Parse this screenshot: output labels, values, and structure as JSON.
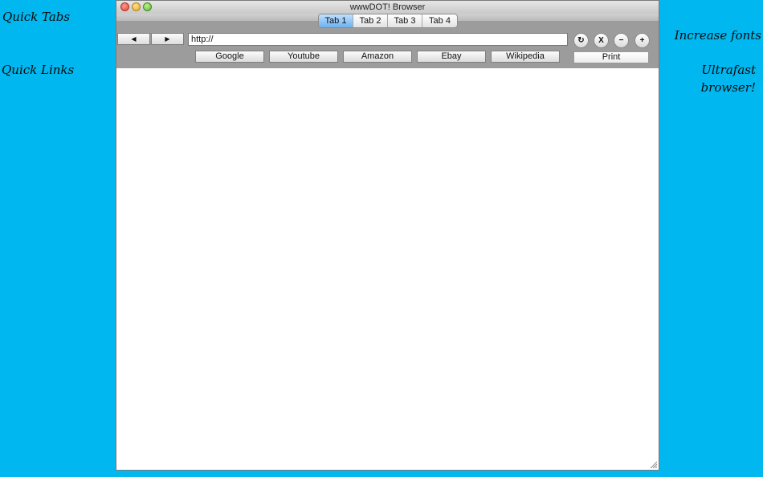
{
  "callouts": {
    "quick_tabs": "Quick Tabs",
    "quick_links": "Quick Links",
    "increase_fonts": "Increase fonts",
    "ultrafast_line1": "Ultrafast",
    "ultrafast_line2": "browser!"
  },
  "window": {
    "title": "wwwDOT! Browser"
  },
  "tabs": [
    {
      "label": "Tab 1",
      "active": true
    },
    {
      "label": "Tab 2",
      "active": false
    },
    {
      "label": "Tab 3",
      "active": false
    },
    {
      "label": "Tab 4",
      "active": false
    }
  ],
  "nav": {
    "back_glyph": "◀",
    "forward_glyph": "▶"
  },
  "url": {
    "value": "http://"
  },
  "controls": {
    "reload_glyph": "↻",
    "stop_label": "X",
    "font_decrease": "−",
    "font_increase": "+"
  },
  "quick_links": [
    "Google",
    "Youtube",
    "Amazon",
    "Ebay",
    "Wikipedia"
  ],
  "print_label": "Print",
  "icons": {
    "back": "back-arrow-icon",
    "forward": "forward-arrow-icon",
    "reload": "reload-icon",
    "stop": "stop-icon",
    "resize": "resize-grip-icon"
  },
  "colors": {
    "background": "#00b7ef",
    "active_tab": "#6cb1ee"
  }
}
